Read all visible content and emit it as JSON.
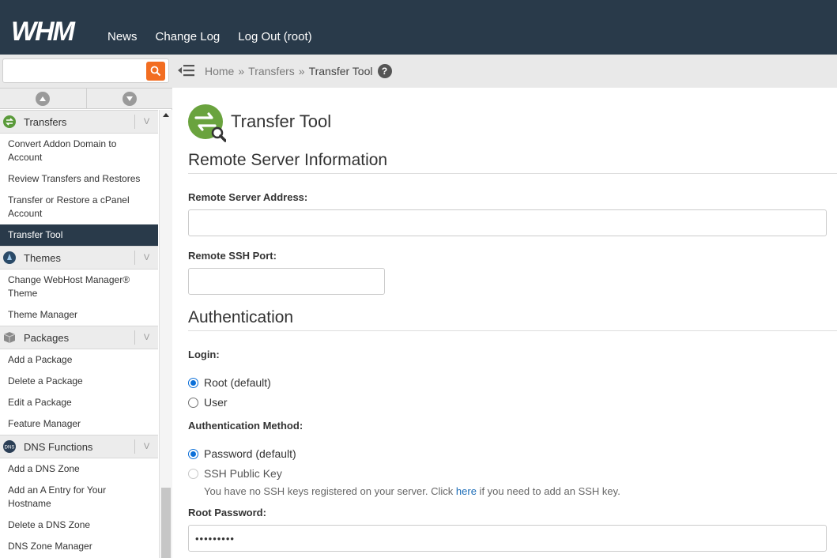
{
  "brand": {
    "logo_text": "WHM"
  },
  "topnav": {
    "news": "News",
    "changelog": "Change Log",
    "logout": "Log Out (root)"
  },
  "sidebar": {
    "search": {
      "value": "",
      "placeholder": ""
    },
    "sections": [
      {
        "name": "Transfers",
        "items": [
          "Convert Addon Domain to Account",
          "Review Transfers and Restores",
          "Transfer or Restore a cPanel Account",
          "Transfer Tool"
        ]
      },
      {
        "name": "Themes",
        "items": [
          "Change WebHost Manager® Theme",
          "Theme Manager"
        ]
      },
      {
        "name": "Packages",
        "items": [
          "Add a Package",
          "Delete a Package",
          "Edit a Package",
          "Feature Manager"
        ]
      },
      {
        "name": "DNS Functions",
        "items": [
          "Add a DNS Zone",
          "Add an A Entry for Your Hostname",
          "Delete a DNS Zone",
          "DNS Zone Manager"
        ]
      }
    ],
    "active_item": "Transfer Tool"
  },
  "breadcrumb": {
    "home": "Home",
    "section": "Transfers",
    "current": "Transfer Tool",
    "sep": "»"
  },
  "page": {
    "title": "Transfer Tool",
    "remote_section": "Remote Server Information",
    "remote_address_label": "Remote Server Address:",
    "remote_address_value": "",
    "remote_port_label": "Remote SSH Port:",
    "remote_port_value": "",
    "auth_section": "Authentication",
    "login_label": "Login:",
    "login_options": [
      "Root (default)",
      "User"
    ],
    "login_selected": "Root (default)",
    "method_label": "Authentication Method:",
    "method_options": [
      "Password (default)",
      "SSH Public Key"
    ],
    "method_selected": "Password (default)",
    "ssh_hint_before": "You have no SSH keys registered on your server. Click ",
    "ssh_hint_link": "here",
    "ssh_hint_after": " if you need to add an SSH key.",
    "root_password_label": "Root Password:",
    "root_password_value": "•••••••••"
  },
  "colors": {
    "topbar": "#293a4a",
    "accent": "#f26d21",
    "active": "#293a4a",
    "link": "#1b6cb7",
    "radio": "#0b6fd8"
  }
}
